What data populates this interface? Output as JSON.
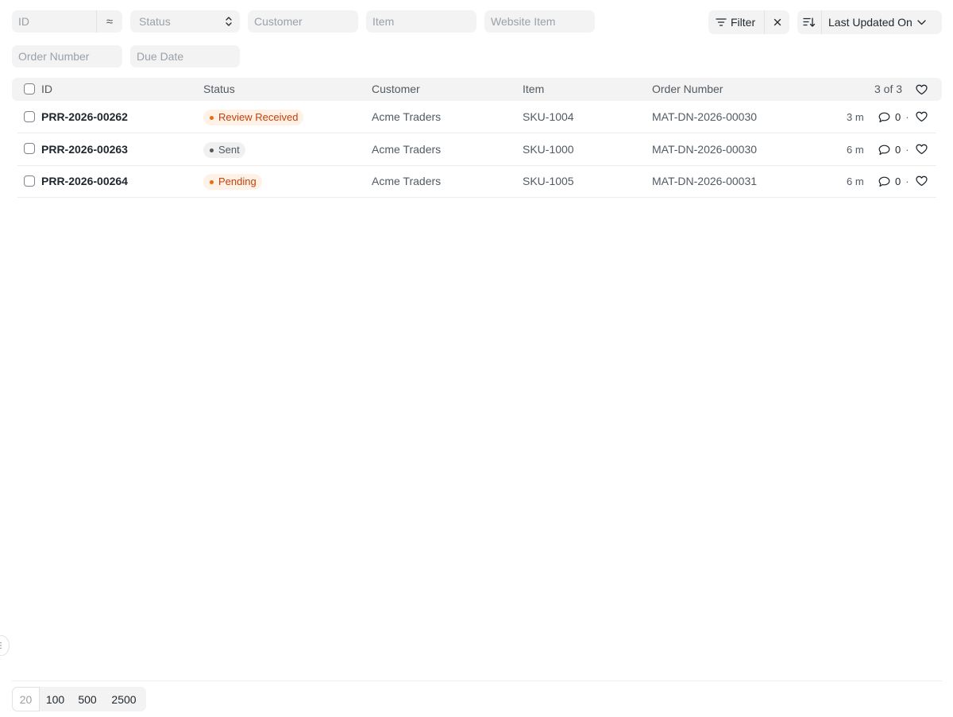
{
  "filters": {
    "id_placeholder": "ID",
    "status_placeholder": "Status",
    "customer_placeholder": "Customer",
    "item_placeholder": "Item",
    "website_item_placeholder": "Website Item",
    "order_number_placeholder": "Order Number",
    "due_date_placeholder": "Due Date"
  },
  "toolbar": {
    "filter_label": "Filter",
    "sort_field": "Last Updated On"
  },
  "header": {
    "id": "ID",
    "status": "Status",
    "customer": "Customer",
    "item": "Item",
    "order_number": "Order Number",
    "count": "3 of 3"
  },
  "rows": [
    {
      "id": "PRR-2026-00262",
      "status": "Review Received",
      "status_color": "orange",
      "customer": "Acme Traders",
      "item": "SKU-1004",
      "order_number": "MAT-DN-2026-00030",
      "modified": "3 m",
      "comments": "0"
    },
    {
      "id": "PRR-2026-00263",
      "status": "Sent",
      "status_color": "gray",
      "customer": "Acme Traders",
      "item": "SKU-1000",
      "order_number": "MAT-DN-2026-00030",
      "modified": "6 m",
      "comments": "0"
    },
    {
      "id": "PRR-2026-00264",
      "status": "Pending",
      "status_color": "orange",
      "customer": "Acme Traders",
      "item": "SKU-1005",
      "order_number": "MAT-DN-2026-00031",
      "modified": "6 m",
      "comments": "0"
    }
  ],
  "paging": {
    "sizes": [
      "20",
      "100",
      "500",
      "2500"
    ]
  },
  "colors": {
    "orange_text": "#c2410c",
    "orange_bg": "#fff1e6",
    "gray_bg": "#f0f0f0",
    "control_bg": "#f3f3f3"
  }
}
